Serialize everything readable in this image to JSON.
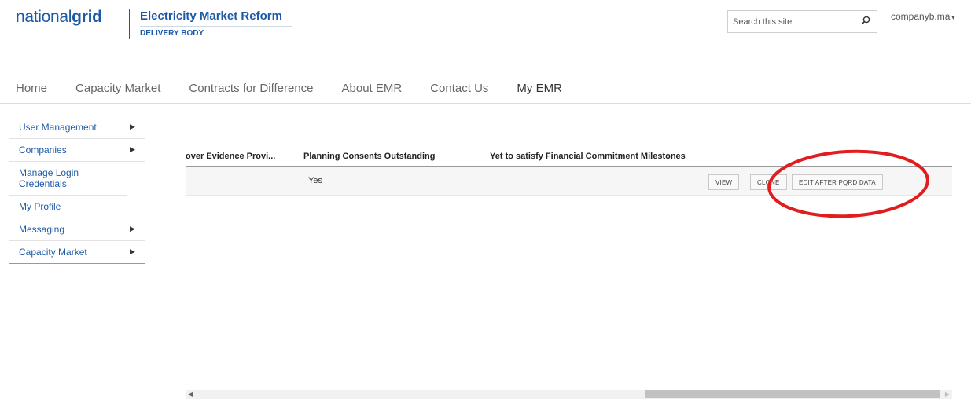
{
  "header": {
    "logo_part1": "national",
    "logo_part2": "grid",
    "brand_title": "Electricity Market Reform",
    "brand_subtitle": "DELIVERY BODY",
    "search_placeholder": "Search this site",
    "user_name": "companyb.ma",
    "user_caret": "▾"
  },
  "nav": {
    "items": [
      {
        "label": "Home"
      },
      {
        "label": "Capacity Market"
      },
      {
        "label": "Contracts for Difference"
      },
      {
        "label": "About EMR"
      },
      {
        "label": "Contact Us"
      },
      {
        "label": "My EMR",
        "active": true
      }
    ]
  },
  "sidebar": {
    "items": [
      {
        "label": "User Management",
        "arrow": "▶"
      },
      {
        "label": "Companies",
        "arrow": "▶"
      },
      {
        "label": "Manage Login Credentials"
      },
      {
        "label": "My Profile"
      },
      {
        "label": "Messaging",
        "arrow": "▶"
      },
      {
        "label": "Capacity Market",
        "arrow": "▶"
      }
    ]
  },
  "table": {
    "columns": [
      "over Evidence Provi...",
      "Planning Consents Outstanding",
      "Yet to satisfy Financial Commitment Milestones"
    ],
    "row": {
      "planning_consents": "Yes",
      "view_label": "VIEW",
      "clone_label": "CLONE",
      "edit_label": "EDIT AFTER PQRD DATA"
    }
  },
  "scrollbar": {
    "left_arrow": "◀",
    "right_arrow": "▶"
  },
  "colors": {
    "brand": "#1d5aa6",
    "nav_active_underline": "#1e8a7f",
    "highlight_ring": "#e11d1d"
  }
}
